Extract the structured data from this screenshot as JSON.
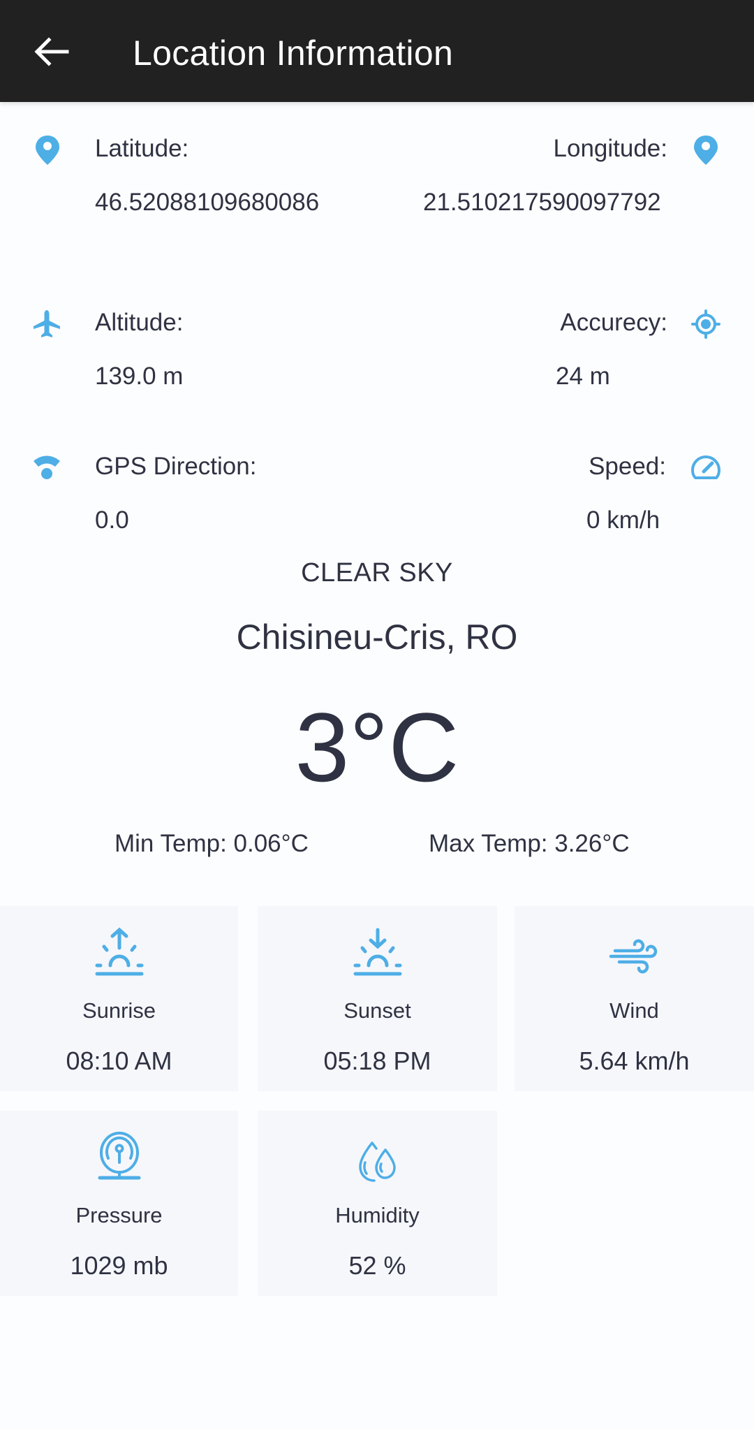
{
  "header": {
    "title": "Location Information",
    "back_icon": "arrow-back-icon"
  },
  "location": {
    "latitude": {
      "label": "Latitude:",
      "value": "46.52088109680086",
      "icon": "map-pin-icon"
    },
    "longitude": {
      "label": "Longitude:",
      "value": "21.510217590097792",
      "icon": "map-pin-icon"
    },
    "altitude": {
      "label": "Altitude:",
      "value": "139.0 m",
      "icon": "airplane-icon"
    },
    "accuracy": {
      "label": "Accurecy:",
      "value": "24 m",
      "icon": "gps-target-icon"
    },
    "gps_direction": {
      "label": "GPS Direction:",
      "value": "0.0",
      "icon": "signal-icon"
    },
    "speed": {
      "label": "Speed:",
      "value": "0 km/h",
      "icon": "speedometer-icon"
    }
  },
  "weather": {
    "condition": "CLEAR SKY",
    "city": "Chisineu-Cris, RO",
    "temperature": "3°C",
    "min_temp": "Min Temp: 0.06°C",
    "max_temp": "Max Temp: 3.26°C",
    "cards": [
      {
        "title": "Sunrise",
        "value": "08:10 AM",
        "icon": "sunrise-icon"
      },
      {
        "title": "Sunset",
        "value": "05:18 PM",
        "icon": "sunset-icon"
      },
      {
        "title": "Wind",
        "value": "5.64 km/h",
        "icon": "wind-icon"
      },
      {
        "title": "Pressure",
        "value": "1029 mb",
        "icon": "barometer-icon"
      },
      {
        "title": "Humidity",
        "value": "52 %",
        "icon": "humidity-drops-icon"
      }
    ]
  },
  "colors": {
    "accent": "#4eaee6",
    "appbar": "#212121",
    "text": "#2f3242",
    "card_bg": "#f6f7fb"
  }
}
